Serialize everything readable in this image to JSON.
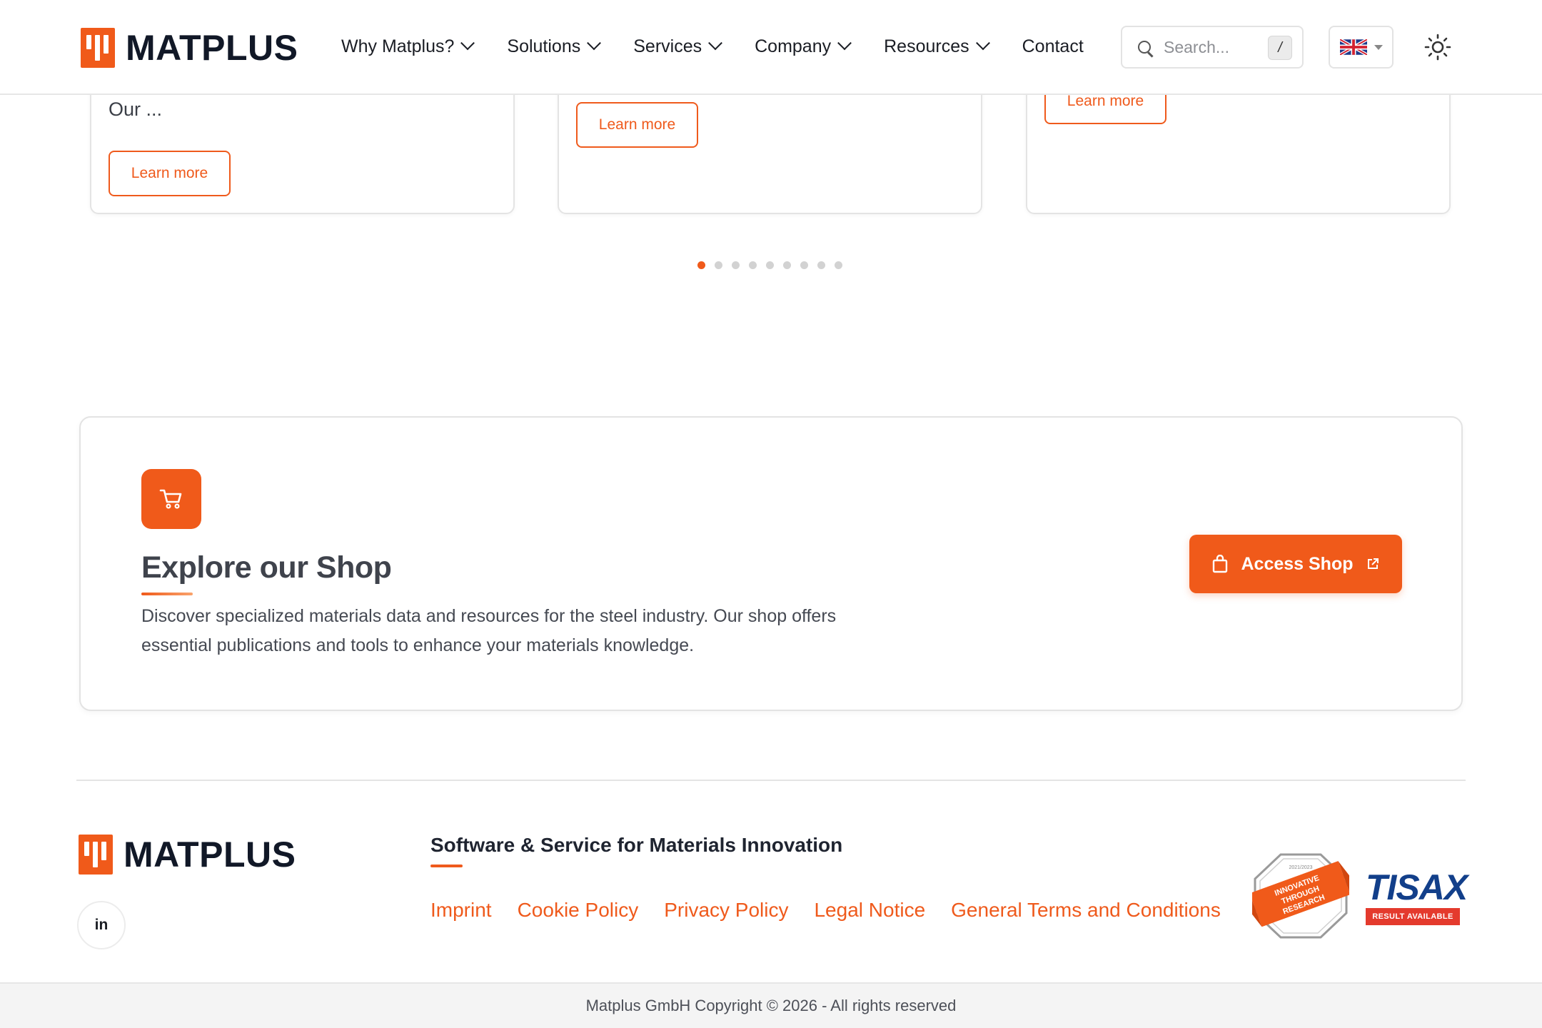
{
  "header": {
    "logo_text": "MATPLUS",
    "nav": [
      {
        "label": "Why Matplus?",
        "has_dropdown": true
      },
      {
        "label": "Solutions",
        "has_dropdown": true
      },
      {
        "label": "Services",
        "has_dropdown": true
      },
      {
        "label": "Company",
        "has_dropdown": true
      },
      {
        "label": "Resources",
        "has_dropdown": true
      },
      {
        "label": "Contact",
        "has_dropdown": false
      }
    ],
    "search": {
      "placeholder": "Search...",
      "shortcut": "/"
    },
    "language": {
      "icon": "uk-flag-icon"
    },
    "theme_toggle": {
      "icon": "sun-icon"
    }
  },
  "cards": [
    {
      "text": "Our ...",
      "button": "Learn more"
    },
    {
      "text": "",
      "button": "Learn more"
    },
    {
      "text": "",
      "button": "Learn more"
    }
  ],
  "carousel": {
    "total": 9,
    "active": 0
  },
  "shop": {
    "icon": "cart-icon",
    "title": "Explore our Shop",
    "description": "Discover specialized materials data and resources for the steel industry. Our shop offers essential publications and tools to enhance your materials knowledge.",
    "button": "Access Shop"
  },
  "footer": {
    "logo_text": "MATPLUS",
    "social": "in",
    "tagline": "Software & Service for Materials Innovation",
    "links": [
      "Imprint",
      "Cookie Policy",
      "Privacy Policy",
      "Legal Notice",
      "General Terms and Conditions"
    ],
    "badges": {
      "innovative": {
        "year": "2021/2023",
        "lines": [
          "INNOVATIVE",
          "THROUGH",
          "RESEARCH"
        ]
      },
      "tisax": {
        "word": "TISAX",
        "sub": "RESULT AVAILABLE"
      }
    },
    "copyright": "Matplus GmbH Copyright © 2026 - All rights reserved"
  },
  "colors": {
    "accent": "#f05a1a",
    "text": "#1f2430",
    "border": "#e4e4e4"
  }
}
